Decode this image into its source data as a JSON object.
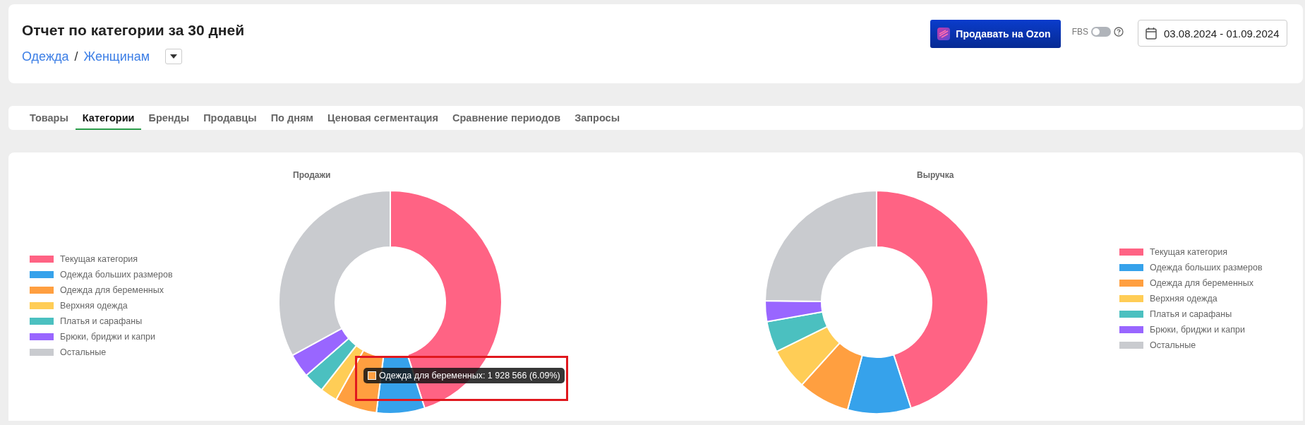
{
  "header": {
    "title": "Отчет по категории за 30 дней",
    "breadcrumbs": [
      "Одежда",
      "Женщинам"
    ],
    "separator": "/",
    "sell_button": "Продавать на Ozon",
    "fbs": {
      "label": "FBS",
      "on": false
    },
    "date_range": "03.08.2024 - 01.09.2024"
  },
  "tabs": [
    {
      "label": "Товары",
      "selected": false
    },
    {
      "label": "Категории",
      "selected": true
    },
    {
      "label": "Бренды",
      "selected": false
    },
    {
      "label": "Продавцы",
      "selected": false
    },
    {
      "label": "По дням",
      "selected": false
    },
    {
      "label": "Ценовая сегментация",
      "selected": false
    },
    {
      "label": "Сравнение периодов",
      "selected": false
    },
    {
      "label": "Запросы",
      "selected": false
    }
  ],
  "charts": [
    {
      "title": "Продажи",
      "legend": [
        {
          "label": "Текущая категория",
          "color": "#ff6384"
        },
        {
          "label": "Одежда больших размеров",
          "color": "#36a2eb"
        },
        {
          "label": "Одежда для беременных",
          "color": "#ff9f40"
        },
        {
          "label": "Верхняя одежда",
          "color": "#ffcd56"
        },
        {
          "label": "Платья и сарафаны",
          "color": "#4bc0c0"
        },
        {
          "label": "Брюки, бриджи и капри",
          "color": "#9966ff"
        },
        {
          "label": "Остальные",
          "color": "#c9cbcf"
        }
      ],
      "tooltip": {
        "color": "#ff9f40",
        "text": "Одежда для беременных: 1 928 566 (6.09%)"
      }
    },
    {
      "title": "Выручка",
      "legend": [
        {
          "label": "Текущая категория",
          "color": "#ff6384"
        },
        {
          "label": "Одежда больших размеров",
          "color": "#36a2eb"
        },
        {
          "label": "Одежда для беременных",
          "color": "#ff9f40"
        },
        {
          "label": "Верхняя одежда",
          "color": "#ffcd56"
        },
        {
          "label": "Платья и сарафаны",
          "color": "#4bc0c0"
        },
        {
          "label": "Брюки, бриджи и капри",
          "color": "#9966ff"
        },
        {
          "label": "Остальные",
          "color": "#c9cbcf"
        }
      ]
    }
  ]
}
